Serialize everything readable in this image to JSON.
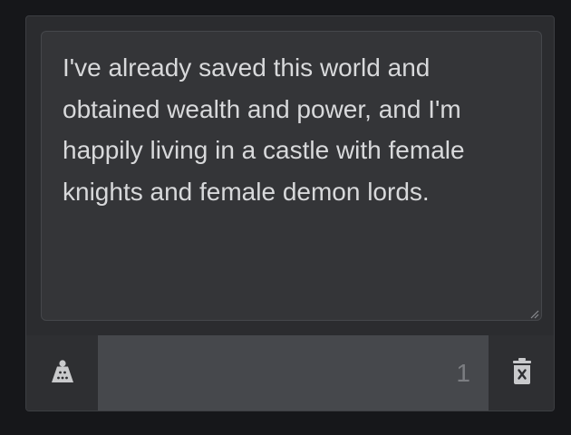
{
  "entry": {
    "text": "I've already saved this world and\nobtained wealth and power, and I'm\nhappily living in a castle with female\nknights and female demon lords.",
    "quantity": "1"
  },
  "icons": {
    "weight": "weight-icon",
    "delete": "trash-icon",
    "resize": "resize-handle-icon"
  },
  "colors": {
    "background": "#16171a",
    "card": "#2b2c2f",
    "textarea": "#343538",
    "text": "#d8d9db",
    "quantity_field": "#46484c",
    "icon": "#c9cacc"
  }
}
